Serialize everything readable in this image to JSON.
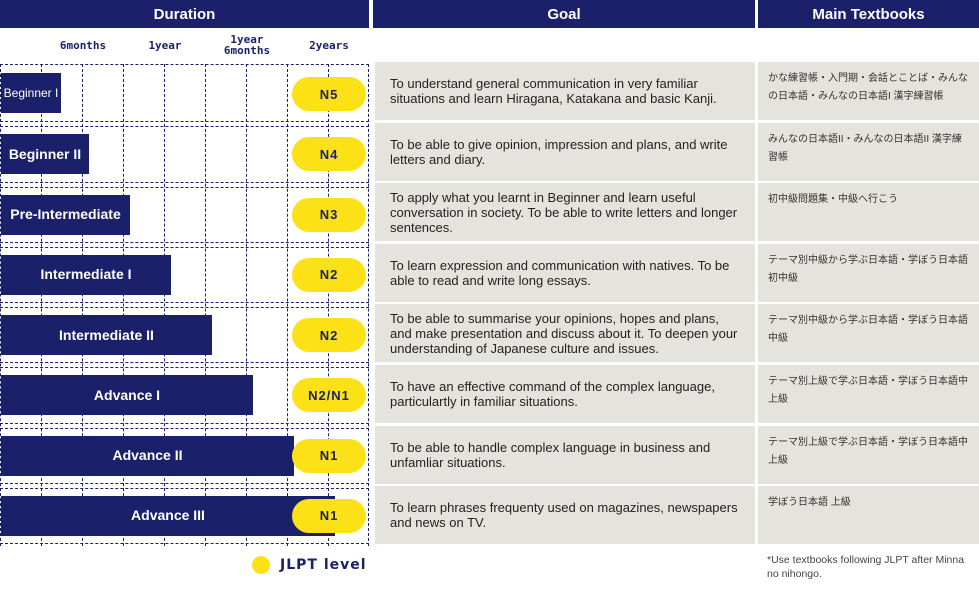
{
  "headers": {
    "duration": "Duration",
    "goal": "Goal",
    "textbooks": "Main Textbooks"
  },
  "chart_data": {
    "type": "bar",
    "orientation": "horizontal",
    "title": "Duration",
    "x_unit": "months",
    "xlim": [
      0,
      27
    ],
    "x_ticks": [
      {
        "value": 6,
        "label": "6months"
      },
      {
        "value": 12,
        "label": "1year"
      },
      {
        "value": 18,
        "label": "1year\n6months"
      },
      {
        "value": 24,
        "label": "2years"
      }
    ],
    "grid": true,
    "categories": [
      "Beginner I",
      "Beginner II",
      "Pre-Intermediate",
      "Intermediate I",
      "Intermediate II",
      "Advance I",
      "Advance II",
      "Advance III"
    ],
    "values": [
      4,
      6.5,
      9.5,
      12.5,
      15.5,
      18.5,
      21.5,
      24.5
    ],
    "jlpt_levels": [
      "N5",
      "N4",
      "N3",
      "N2",
      "N2",
      "N2/N1",
      "N1",
      "N1"
    ],
    "legend": {
      "label": "JLPT level",
      "color": "#fbe115",
      "position": "bottom-right"
    },
    "bar_color": "#1b206b"
  },
  "rows": [
    {
      "level": "Beginner I",
      "jlpt": "N5",
      "goal": "To understand general communication in very familiar situations and learn Hiragana, Katakana and basic Kanji.",
      "textbooks": "かな練習帳・入門期・会話とことば・みんなの日本語・みんなの日本語I 漢字練習帳"
    },
    {
      "level": "Beginner II",
      "jlpt": "N4",
      "goal": "To be able to give opinion, impression and plans, and write letters and diary.",
      "textbooks": "みんなの日本語II・みんなの日本語II 漢字練習帳"
    },
    {
      "level": "Pre-Intermediate",
      "jlpt": "N3",
      "goal": "To apply what you learnt in Beginner and learn useful conversation in society. To be able to write letters and longer sentences.",
      "textbooks": "初中級問題集・中級へ行こう"
    },
    {
      "level": "Intermediate I",
      "jlpt": "N2",
      "goal": "To learn expression and communication with natives. To be able to read and write long essays.",
      "textbooks": "テーマ別中級から学ぶ日本語・学ぼう日本語 初中級"
    },
    {
      "level": "Intermediate II",
      "jlpt": "N2",
      "goal": "To be able to summarise your opinions, hopes and plans, and make presentation and discuss about it. To deepen your understanding of Japanese culture and issues.",
      "textbooks": "テーマ別中級から学ぶ日本語・学ぼう日本語 中級"
    },
    {
      "level": "Advance I",
      "jlpt": "N2/N1",
      "goal": "To have an effective command of the complex language, particulartly in familiar situations.",
      "textbooks": "テーマ別上級で学ぶ日本語・学ぼう日本語中上級"
    },
    {
      "level": "Advance II",
      "jlpt": "N1",
      "goal": "To be able to handle complex language in business and unfamliar situations.",
      "textbooks": "テーマ別上級で学ぶ日本語・学ぼう日本語中上級"
    },
    {
      "level": "Advance III",
      "jlpt": "N1",
      "goal": "To learn phrases frequenty used on magazines, newspapers and news on TV.",
      "textbooks": "学ぼう日本語 上級"
    }
  ],
  "legend_label": "JLPT level",
  "footnote": "*Use textbooks following JLPT after Minna no nihongo."
}
